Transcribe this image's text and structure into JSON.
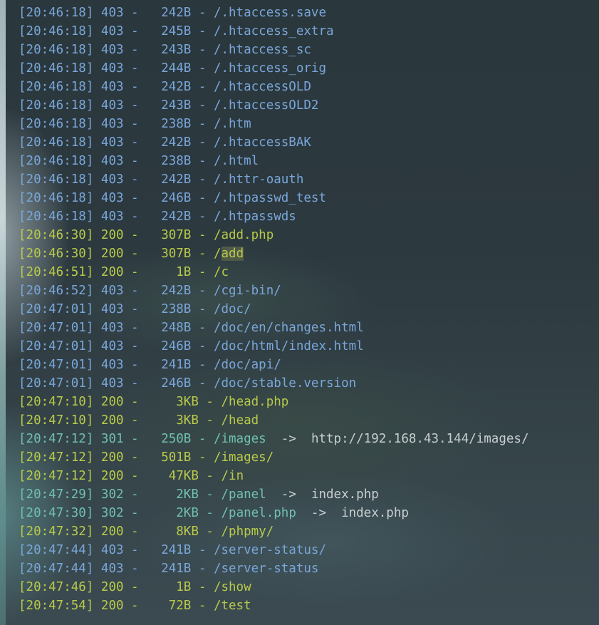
{
  "terminal": {
    "lines": [
      {
        "time": "[20:46:18]",
        "status": "403",
        "size": "  242B",
        "path": "/.htaccess.save",
        "kind": "c403"
      },
      {
        "time": "[20:46:18]",
        "status": "403",
        "size": "  245B",
        "path": "/.htaccess_extra",
        "kind": "c403"
      },
      {
        "time": "[20:46:18]",
        "status": "403",
        "size": "  243B",
        "path": "/.htaccess_sc",
        "kind": "c403"
      },
      {
        "time": "[20:46:18]",
        "status": "403",
        "size": "  244B",
        "path": "/.htaccess_orig",
        "kind": "c403"
      },
      {
        "time": "[20:46:18]",
        "status": "403",
        "size": "  242B",
        "path": "/.htaccessOLD",
        "kind": "c403"
      },
      {
        "time": "[20:46:18]",
        "status": "403",
        "size": "  243B",
        "path": "/.htaccessOLD2",
        "kind": "c403"
      },
      {
        "time": "[20:46:18]",
        "status": "403",
        "size": "  238B",
        "path": "/.htm",
        "kind": "c403"
      },
      {
        "time": "[20:46:18]",
        "status": "403",
        "size": "  242B",
        "path": "/.htaccessBAK",
        "kind": "c403"
      },
      {
        "time": "[20:46:18]",
        "status": "403",
        "size": "  238B",
        "path": "/.html",
        "kind": "c403"
      },
      {
        "time": "[20:46:18]",
        "status": "403",
        "size": "  242B",
        "path": "/.httr-oauth",
        "kind": "c403"
      },
      {
        "time": "[20:46:18]",
        "status": "403",
        "size": "  246B",
        "path": "/.htpasswd_test",
        "kind": "c403"
      },
      {
        "time": "[20:46:18]",
        "status": "403",
        "size": "  242B",
        "path": "/.htpasswds",
        "kind": "c403"
      },
      {
        "time": "[20:46:30]",
        "status": "200",
        "size": "  307B",
        "path": "/add.php",
        "kind": "c200"
      },
      {
        "time": "[20:46:30]",
        "status": "200",
        "size": "  307B",
        "path_prefix": "/",
        "path_highlight": "add",
        "kind": "c200"
      },
      {
        "time": "[20:46:51]",
        "status": "200",
        "size": "    1B",
        "path": "/c",
        "kind": "c200"
      },
      {
        "time": "[20:46:52]",
        "status": "403",
        "size": "  242B",
        "path": "/cgi-bin/",
        "kind": "c403"
      },
      {
        "time": "[20:47:01]",
        "status": "403",
        "size": "  238B",
        "path": "/doc/",
        "kind": "c403"
      },
      {
        "time": "[20:47:01]",
        "status": "403",
        "size": "  248B",
        "path": "/doc/en/changes.html",
        "kind": "c403"
      },
      {
        "time": "[20:47:01]",
        "status": "403",
        "size": "  246B",
        "path": "/doc/html/index.html",
        "kind": "c403"
      },
      {
        "time": "[20:47:01]",
        "status": "403",
        "size": "  241B",
        "path": "/doc/api/",
        "kind": "c403"
      },
      {
        "time": "[20:47:01]",
        "status": "403",
        "size": "  246B",
        "path": "/doc/stable.version",
        "kind": "c403"
      },
      {
        "time": "[20:47:10]",
        "status": "200",
        "size": "    3KB",
        "path": "/head.php",
        "kind": "c200"
      },
      {
        "time": "[20:47:10]",
        "status": "200",
        "size": "    3KB",
        "path": "/head",
        "kind": "c200"
      },
      {
        "time": "[20:47:12]",
        "status": "301",
        "size": "  250B",
        "path": "/images",
        "arrow": "  ->  ",
        "target": "http://192.168.43.144/images/",
        "kind": "c30x"
      },
      {
        "time": "[20:47:12]",
        "status": "200",
        "size": "  501B",
        "path": "/images/",
        "kind": "c200"
      },
      {
        "time": "[20:47:12]",
        "status": "200",
        "size": "   47KB",
        "path": "/in",
        "kind": "c200"
      },
      {
        "time": "[20:47:29]",
        "status": "302",
        "size": "    2KB",
        "path": "/panel",
        "arrow": "  ->  ",
        "target": "index.php",
        "kind": "c30x"
      },
      {
        "time": "[20:47:30]",
        "status": "302",
        "size": "    2KB",
        "path": "/panel.php",
        "arrow": "  ->  ",
        "target": "index.php",
        "kind": "c30x"
      },
      {
        "time": "[20:47:32]",
        "status": "200",
        "size": "    8KB",
        "path": "/phpmy/",
        "kind": "c200"
      },
      {
        "time": "[20:47:44]",
        "status": "403",
        "size": "  241B",
        "path": "/server-status/",
        "kind": "c403"
      },
      {
        "time": "[20:47:44]",
        "status": "403",
        "size": "  241B",
        "path": "/server-status",
        "kind": "c403"
      },
      {
        "time": "[20:47:46]",
        "status": "200",
        "size": "    1B",
        "path": "/show",
        "kind": "c200"
      },
      {
        "time": "[20:47:54]",
        "status": "200",
        "size": "   72B",
        "path": "/test",
        "kind": "c200"
      }
    ]
  },
  "colors": {
    "status_403": "#7aa6da",
    "status_200": "#b9ca4a",
    "status_30x": "#70c0b1",
    "redirect_target": "#c8ced1"
  }
}
